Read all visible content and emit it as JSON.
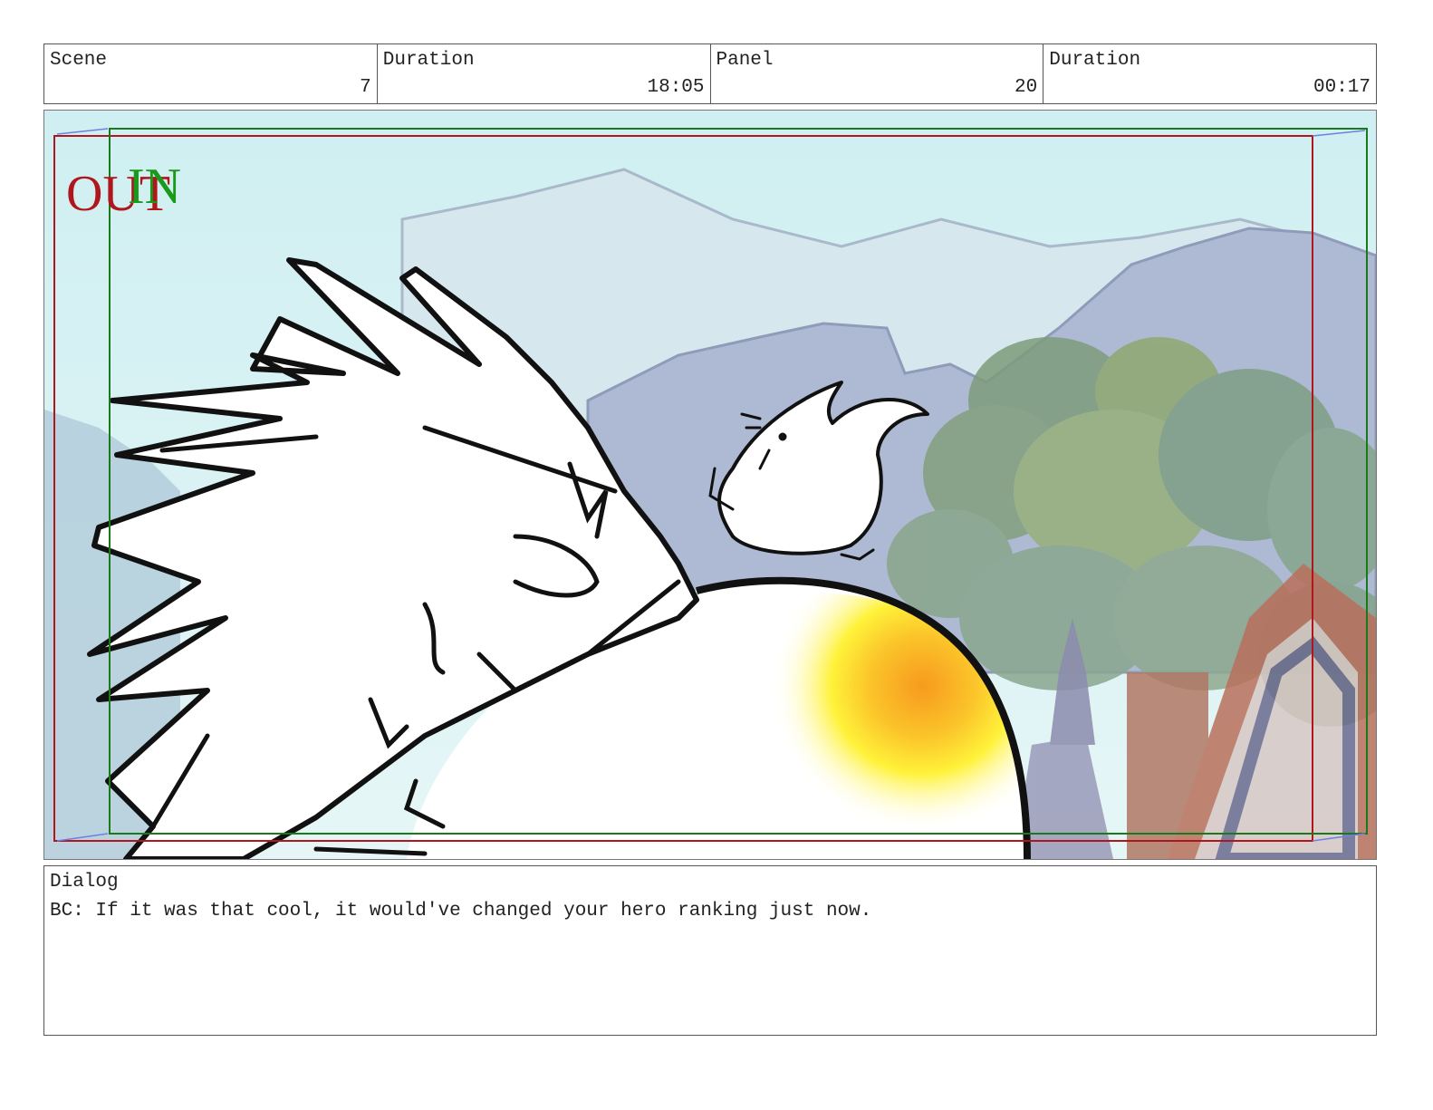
{
  "header": {
    "scene_label": "Scene",
    "scene_value": "7",
    "scene_duration_label": "Duration",
    "scene_duration_value": "18:05",
    "panel_label": "Panel",
    "panel_value": "20",
    "panel_duration_label": "Duration",
    "panel_duration_value": "00:17"
  },
  "frame": {
    "out_label": "OUT",
    "in_label": "IN",
    "out_color": "#b0161b",
    "in_color": "#1a9a1a"
  },
  "dialog": {
    "label": "Dialog",
    "text": "BC: If it was that cool, it would've changed your hero ranking just now."
  }
}
